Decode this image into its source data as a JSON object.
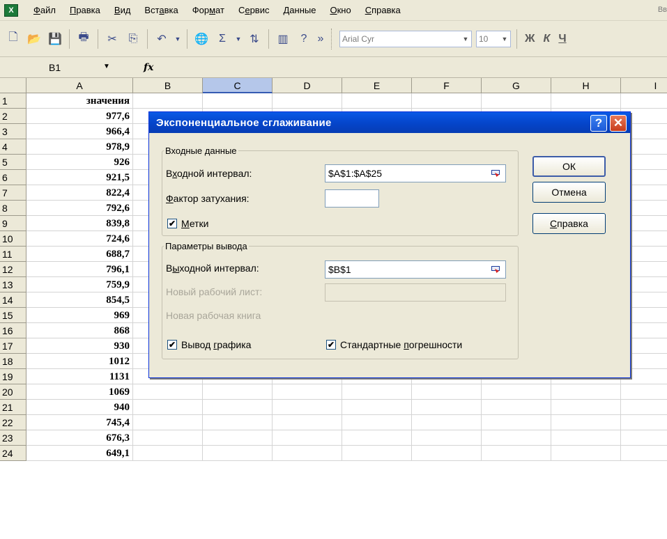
{
  "menu": {
    "items": [
      {
        "pre": "",
        "u": "Ф",
        "post": "айл"
      },
      {
        "pre": "",
        "u": "П",
        "post": "равка"
      },
      {
        "pre": "",
        "u": "В",
        "post": "ид"
      },
      {
        "pre": "Вст",
        "u": "а",
        "post": "вка"
      },
      {
        "pre": "Фор",
        "u": "м",
        "post": "ат"
      },
      {
        "pre": "С",
        "u": "е",
        "post": "рвис"
      },
      {
        "pre": "",
        "u": "Д",
        "post": "анные"
      },
      {
        "pre": "",
        "u": "О",
        "post": "кно"
      },
      {
        "pre": "",
        "u": "С",
        "post": "правка"
      }
    ],
    "clipped_text": "Вв"
  },
  "toolbar": {
    "font_name": "Arial Cyr",
    "font_size": "10",
    "bold_label": "Ж",
    "italic_label": "К",
    "underline_label": "Ч"
  },
  "formula_bar": {
    "name_box": "B1",
    "fx_label": "fx"
  },
  "grid": {
    "columns": [
      "A",
      "B",
      "C",
      "D",
      "E",
      "F",
      "G",
      "H",
      "I"
    ],
    "selected_column": "C",
    "rows": [
      {
        "n": "1",
        "a": "значения"
      },
      {
        "n": "2",
        "a": "977,6"
      },
      {
        "n": "3",
        "a": "966,4"
      },
      {
        "n": "4",
        "a": "978,9"
      },
      {
        "n": "5",
        "a": "926"
      },
      {
        "n": "6",
        "a": "921,5"
      },
      {
        "n": "7",
        "a": "822,4"
      },
      {
        "n": "8",
        "a": "792,6"
      },
      {
        "n": "9",
        "a": "839,8"
      },
      {
        "n": "10",
        "a": "724,6"
      },
      {
        "n": "11",
        "a": "688,7"
      },
      {
        "n": "12",
        "a": "796,1"
      },
      {
        "n": "13",
        "a": "759,9"
      },
      {
        "n": "14",
        "a": "854,5"
      },
      {
        "n": "15",
        "a": "969"
      },
      {
        "n": "16",
        "a": "868"
      },
      {
        "n": "17",
        "a": "930"
      },
      {
        "n": "18",
        "a": "1012"
      },
      {
        "n": "19",
        "a": "1131"
      },
      {
        "n": "20",
        "a": "1069"
      },
      {
        "n": "21",
        "a": "940"
      },
      {
        "n": "22",
        "a": "745,4"
      },
      {
        "n": "23",
        "a": "676,3"
      },
      {
        "n": "24",
        "a": "649,1"
      }
    ]
  },
  "dialog": {
    "title": "Экспоненциальное сглаживание",
    "help_icon": "?",
    "close_icon": "✕",
    "input_group": "Входные данные",
    "input_range_label_pre": "В",
    "input_range_label_u": "х",
    "input_range_label_post": "одной интервал:",
    "input_range_value": "$A$1:$A$25",
    "damping_label_u": "Ф",
    "damping_label_post": "актор затухания:",
    "damping_value": "",
    "labels_check_u": "М",
    "labels_check_post": "етки",
    "labels_checked": true,
    "output_group": "Параметры вывода",
    "output_range_label_pre": "В",
    "output_range_label_u": "ы",
    "output_range_label_post": "ходной интервал:",
    "output_range_value": "$B$1",
    "new_sheet_label": "Новый рабочий лист:",
    "new_sheet_value": "",
    "new_book_label": "Новая рабочая книга",
    "chart_output_pre": "Вывод ",
    "chart_output_u": "г",
    "chart_output_post": "рафика",
    "chart_output_checked": true,
    "std_errors_pre": "Стандартные ",
    "std_errors_u": "п",
    "std_errors_post": "огрешности",
    "std_errors_checked": true,
    "ok_label": "ОК",
    "cancel_label": "Отмена",
    "help_label_u": "С",
    "help_label_post": "правка",
    "check_mark": "✔"
  },
  "colors": {
    "title_bar": "#0546cc",
    "dialog_bg": "#ece9d8",
    "selected_header": "#b5c7ea"
  }
}
